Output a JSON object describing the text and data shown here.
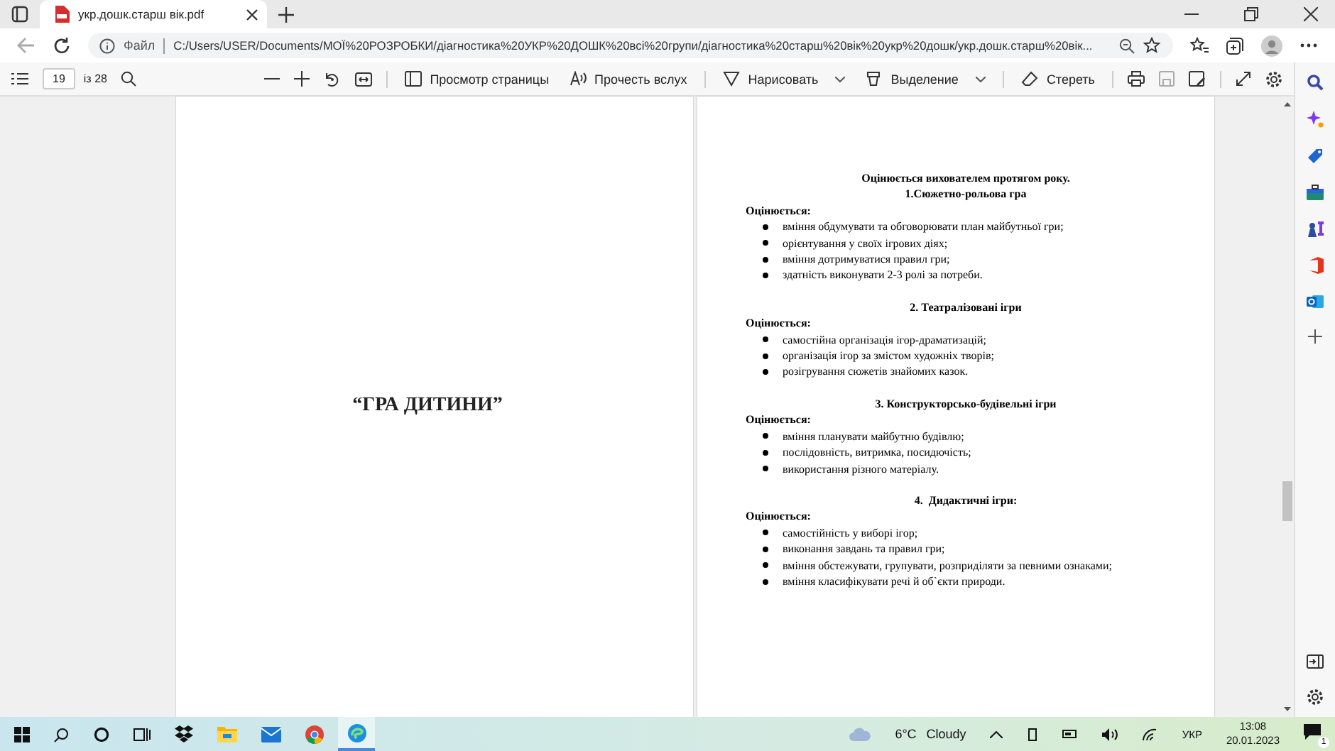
{
  "tab": {
    "title": "укр.дошк.старш вік.pdf",
    "selected": true
  },
  "address": {
    "label": "Файл",
    "url": "C:/Users/USER/Documents/МОЇ%20РОЗРОБКИ/діагностика%20УКР%20ДОШК%20всі%20групи/діагностика%20старш%20вік%20укр%20дошк/укр.дошк.старш%20вік..."
  },
  "pdf_toolbar": {
    "page": "19",
    "page_count": "із 28",
    "buttons": [
      {
        "label": "Просмотр страницы",
        "kind": "view"
      },
      {
        "label": "Прочесть вслух",
        "kind": "read"
      },
      {
        "label": "Нарисовать",
        "kind": "draw"
      },
      {
        "label": "Выделение",
        "kind": "highlight"
      },
      {
        "label": "Стереть",
        "kind": "erase"
      }
    ]
  },
  "left_page": {
    "title": "“ГРА ДИТИНИ”"
  },
  "right_page": {
    "heading": "Оцінюється вихователем протягом року.",
    "sections": [
      {
        "title": "1.Сюжетно-рольова гра",
        "label": "Оцінюється:",
        "items": [
          "вміння обдумувати та обговорювати план майбутньої гри;",
          "орієнтування у своїх ігрових діях;",
          "вміння дотримуватися правил гри;",
          "здатність виконувати 2-3 ролі за потреби."
        ]
      },
      {
        "title": "2. Театралізовані ігри",
        "label": "Оцінюється:",
        "items": [
          "самостійна організація ігор-драматизацій;",
          "організація ігор за змістом художніх творів;",
          "розігрування сюжетів знайомих казок."
        ]
      },
      {
        "title": "3. Конструкторсько-будівельні ігри",
        "label": "Оцінюється:",
        "items": [
          "вміння планувати майбутню будівлю;",
          "послідовність, витримка, посидючість;",
          "використання різного матеріалу."
        ]
      },
      {
        "title": "4.  Дидактичні ігри:",
        "label": "Оцінюється:",
        "items": [
          "самостійність у виборі ігор;",
          "виконання завдань та правил гри;",
          "вміння обстежувати, групувати, розприділяти за певними ознаками;",
          "вміння класифікувати речі й об`єкти природи."
        ]
      }
    ]
  },
  "taskbar": {
    "temperature": "6°C",
    "weather": "Cloudy",
    "language": "УКР",
    "time": "13:08",
    "date": "20.01.2023",
    "notifications": "1"
  }
}
